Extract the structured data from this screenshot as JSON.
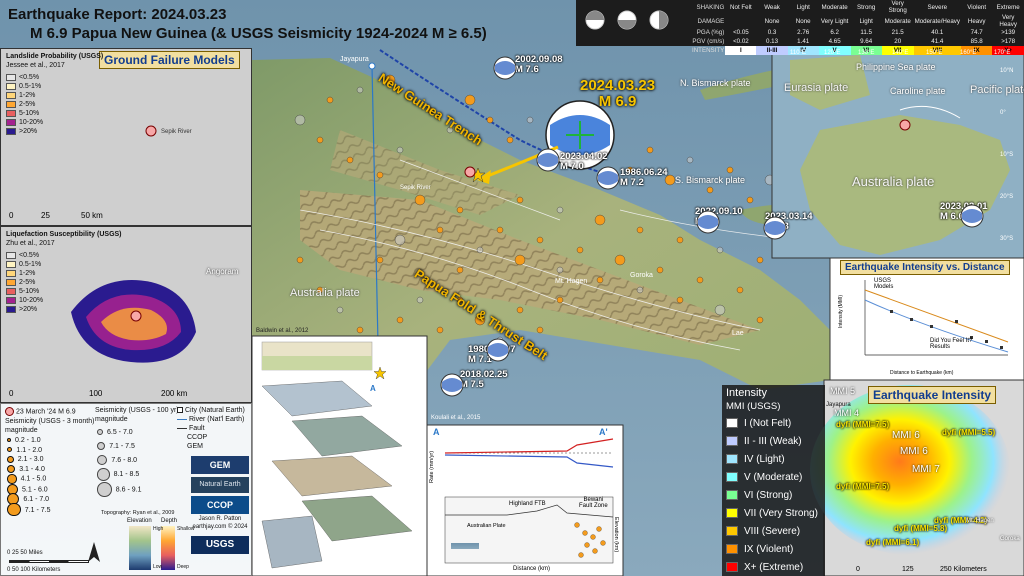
{
  "title": {
    "line1": "Earthquake Report: 2024.03.23",
    "line2": "M 6.9 Papua New Guinea (& USGS Seismicity 1924-2024 M ≥ 6.5)"
  },
  "main_event": {
    "date": "2024.03.23",
    "mag": "M 6.9"
  },
  "past_quakes": [
    {
      "date": "2002.09.08",
      "mag": "M 7.6"
    },
    {
      "date": "2023.04.02",
      "mag": "M 7.0"
    },
    {
      "date": "1986.06.24",
      "mag": "M 7.2"
    },
    {
      "date": "2022.09.10",
      "mag": "M 7.6"
    },
    {
      "date": "2023.03.14",
      "mag": "M 6.3"
    },
    {
      "date": "2023.03.01",
      "mag": "M 6.6"
    },
    {
      "date": "2018.02.25",
      "mag": "M 7.5"
    },
    {
      "date": "1980.12.07",
      "mag": "M 7.1"
    }
  ],
  "map_labels": {
    "trench": "New Guinea Trench",
    "fold_belt": "Papua Fold & Thrust Belt",
    "australia_plate": "Australia plate",
    "n_bismarck": "N. Bismarck plate",
    "s_bismarck": "S. Bismarck plate",
    "jayapura": "Jayapura",
    "mt_hagen": "Mt. Hagen",
    "goroka": "Goroka",
    "lae": "Lae",
    "angoram": "Angoram",
    "sepik": "Sepik River"
  },
  "ground_failure": {
    "title": "Ground Failure Models"
  },
  "landslide": {
    "title": "Landslide Probability (USGS)",
    "cite": "Jessee et al., 2017",
    "classes": [
      "<0.5%",
      "0.5-1%",
      "1-2%",
      "2-5%",
      "5-10%",
      "10-20%",
      ">20%"
    ],
    "colors": [
      "#e6e6e6",
      "#fff4c2",
      "#ffd67a",
      "#ffa733",
      "#e85f5f",
      "#a3228f",
      "#2a1b8f"
    ],
    "scale_0": "0",
    "scale_1": "25",
    "scale_2": "50 km",
    "river": "Sepik River"
  },
  "liquefaction": {
    "title": "Liquefaction Susceptibility (USGS)",
    "cite": "Zhu et al., 2017",
    "classes": [
      "<0.5%",
      "0.5-1%",
      "1-2%",
      "2-5%",
      "5-10%",
      "10-20%",
      ">20%"
    ],
    "scale_0": "0",
    "scale_1": "100",
    "scale_2": "200 km",
    "town": "Angoram"
  },
  "shaking": {
    "headers": [
      "Not Felt",
      "Weak",
      "Light",
      "Moderate",
      "Strong",
      "Very Strong",
      "Severe",
      "Violent",
      "Extreme"
    ],
    "headers2": [
      "",
      "None",
      "None",
      "Very Light",
      "Light",
      "Moderate",
      "Moderate/Heavy",
      "Heavy",
      "Very Heavy"
    ],
    "row_labels": [
      "SHAKING",
      "DAMAGE",
      "PGA (%g)",
      "PGV (cm/s)",
      "INTENSITY"
    ],
    "pga": [
      "<0.05",
      "0.3",
      "2.76",
      "6.2",
      "11.5",
      "21.5",
      "40.1",
      "74.7",
      ">139"
    ],
    "pgv": [
      "<0.02",
      "0.13",
      "1.41",
      "4.65",
      "9.64",
      "20",
      "41.4",
      "85.8",
      ">178"
    ],
    "intensity": [
      "I",
      "II-III",
      "IV",
      "V",
      "VI",
      "VII",
      "VIII",
      "IX",
      "X+"
    ],
    "colors": [
      "#ffffff",
      "#bfccff",
      "#a0e6ff",
      "#80ffff",
      "#7aff93",
      "#ffff00",
      "#ffc800",
      "#ff9100",
      "#ff0000"
    ]
  },
  "intensity_panel": {
    "title": "Earthquake Intensity",
    "labels": [
      "MMI 5",
      "MMI 4",
      "MMI 6",
      "MMI 6",
      "MMI 7"
    ],
    "dyfi": [
      "dyfi (MMI=7.5)",
      "dyfi (MMI=5.5)",
      "dyfi (MMI=7.5)",
      "dyfi (MMI=4.2)",
      "dyfi (MMI=5.8)",
      "dyfi (MMI=6.1)"
    ],
    "towns": [
      "Jayapura",
      "Mt. Hagen",
      "Goroka"
    ],
    "scale_0": "0",
    "scale_1": "125",
    "scale_2": "250 Kilometers"
  },
  "distance_panel": {
    "title": "Earthquake Intensity vs. Distance",
    "usgs_models": "USGS\nModels",
    "dyfi_results": "Did You Feel It?\nResults",
    "xlabel": "Distance to Earthquake (km)",
    "ylabel": "Intensity (MMI)"
  },
  "regional": {
    "eurasia": "Eurasia plate",
    "pacific": "Pacific plate",
    "australia": "Australia plate",
    "caroline": "Caroline plate",
    "philippine": "Philippine Sea plate",
    "lon_ticks": [
      "110°E",
      "120°E",
      "130°E",
      "140°E",
      "150°E",
      "160°E",
      "170°E"
    ],
    "lat_ticks": [
      "10°N",
      "0°",
      "10°S",
      "20°S",
      "30°S"
    ]
  },
  "mmi_legend": {
    "title": "Intensity",
    "subtitle": "MMI (USGS)",
    "rows": [
      "I (Not Felt)",
      "II - III (Weak)",
      "IV (Light)",
      "V (Moderate)",
      "VI (Strong)",
      "VII (Very Strong)",
      "VIII (Severe)",
      "IX (Violent)",
      "X+ (Extreme)"
    ],
    "colors": [
      "#ffffff",
      "#bfccff",
      "#a0e6ff",
      "#80ffff",
      "#7aff93",
      "#ffff00",
      "#ffc800",
      "#ff9100",
      "#ff0000"
    ]
  },
  "cross_section": {
    "cite1": "Baldwin et al., 2012",
    "cite2": "Koulali et al., 2015",
    "a": "A",
    "a_prime": "A'",
    "label_ftb": "Highland FTB",
    "label_bewani": "Bewani\nFault Zone",
    "label_au": "Australian Plate",
    "xlabel": "Distance (km)",
    "ylabel": "Rate (mm/yr)",
    "y2label": "Elevation (km)"
  },
  "legend": {
    "event": "23 March '24 M 6.9",
    "seis3": "Seismicity (USGS - 3 month)",
    "mag": "magnitude",
    "seis3_bins": [
      "0.2 - 1.0",
      "1.1 - 2.0",
      "2.1 - 3.0",
      "3.1 - 4.0",
      "4.1 - 5.0",
      "5.1 - 6.0",
      "6.1 - 7.0",
      "7.1 - 7.5"
    ],
    "seis100": "Seismicity (USGS - 100 yr)",
    "mag100": "magnitude",
    "seis100_bins": [
      "6.5 - 7.0",
      "7.1 - 7.5",
      "7.6 - 8.0",
      "8.1 - 8.5",
      "8.6 - 9.1"
    ],
    "city": "City (Natural Earth)",
    "river": "River (Nat'l Earth)",
    "fault": "Fault",
    "ccop": "CCOP",
    "gem": "GEM",
    "topo": "Topography: Ryan et al., 2009",
    "elev": "Elevation",
    "depth": "Depth",
    "high": "High",
    "low": "Low",
    "shallow": "Shallow",
    "deep": "Deep",
    "author": "Jason R. Patton",
    "site": "earthjay.com © 2024",
    "scale": "0  25  50 Miles",
    "scale2": "0  50  100 Kilometers",
    "logo_gem": "GEM",
    "logo_ne": "Natural Earth",
    "logo_ccop": "CCOP",
    "logo_usgs": "USGS"
  },
  "colors": {
    "quake": "#f39b1d",
    "trench": "#1f44a8",
    "structure_label": "#f0b400",
    "water": "#7fa6bd"
  }
}
